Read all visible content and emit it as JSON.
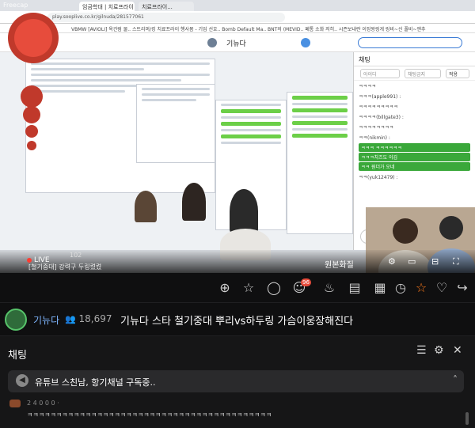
{
  "stream": {
    "watermark": "Freecap",
    "captured_browser": {
      "tabs": [
        "임금학대 | 치료프라이 불...",
        "치료프라이..."
      ],
      "url": "play.sooplive.co.kr/gilnuda/281577061",
      "bookmarks": "VBMW  [AVIOLI] 옥건럼 물..  스트리머/킹  치료프라이  행사봄 - 기업 선호..  Bomb Default Ma..  BNT의 (MEVID..  페통 소화 저히..  시즌보내란  이징왕링게  링비~신  폴비~앤추",
      "site_brand": "기뉴다",
      "chat_header": "채팅",
      "chat_placeholder_id": "아이디",
      "chat_placeholder_msg": "채팅금지",
      "chat_button": "적용",
      "chat_lines": [
        "ㅋㅋㅋㅋ",
        "ㅋㅋㅋ(apple991) :",
        "ㅋㅋㅋㅋㅋㅋㅋㅋㅋ",
        "ㅋㅋㅋㅋ(billgate3) :",
        "ㅋㅋㅋㅋㅋㅋㅋㅋ",
        "ㅋㅋ(nikmin) :",
        "ㅋㅋㅋ ㅋㅋㅋㅋㅋㅋ",
        "ㅋㅋㅋ치즈도 이김",
        "ㅋㅋ 원더가 오네",
        "ㅋㅋ(yuk12479) :"
      ]
    },
    "controls": {
      "live": "LIVE",
      "viewer_count": "102",
      "caption": "[철기중대] 강력구 두링켰켰",
      "quality": "원본화질"
    }
  },
  "toolbar": {
    "icons": [
      "clip-icon",
      "badge-icon",
      "balloon-icon",
      "sticker-icon",
      "cake-icon",
      "film-icon",
      "timer-icon",
      "favorite-icon",
      "like-icon",
      "share-icon"
    ],
    "balloon_badge": "96"
  },
  "channel": {
    "name": "기뉴다",
    "viewers": "18,697",
    "title": "기뉴다 스타 철기중대 뿌리vs하두링 가슴이웅장해진다"
  },
  "chat": {
    "title": "채팅",
    "notice": "유튜브 스친남, 항기채널 구독중..",
    "message_user": "2 4 0 0 0 ·",
    "message_text": "ㅋㅋㅋㅋㅋㅋㅋㅋㅋㅋㅋㅋㅋㅋㅋㅋㅋㅋㅋㅋㅋㅋㅋㅋㅋㅋㅋㅋㅋㅋㅋㅋㅋㅋㅋㅋㅋㅋㅋㅋㅋㅋ"
  },
  "colors": {
    "accent_blue": "#7fb6ff",
    "live_red": "#ff3b30",
    "chat_green": "#3aa83a"
  }
}
